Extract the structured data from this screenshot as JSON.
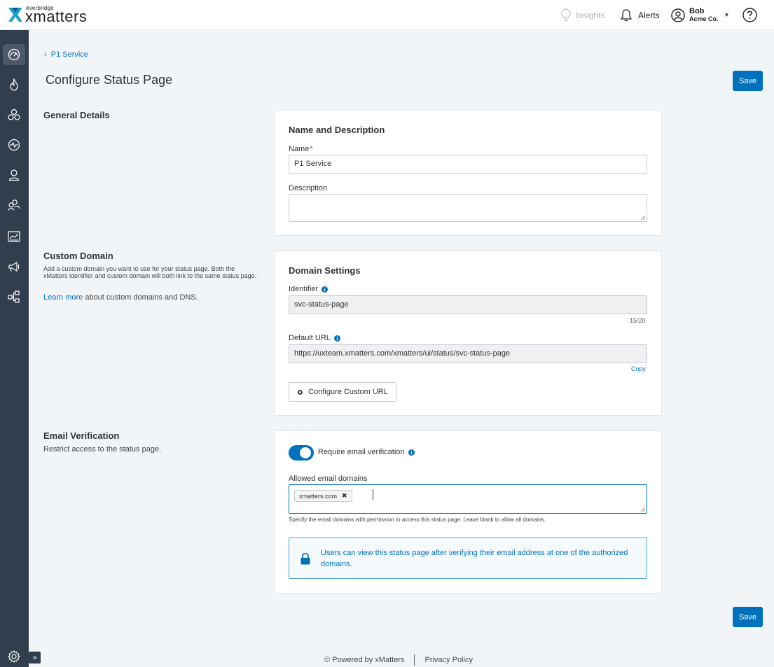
{
  "header": {
    "logo_small": "everbridge",
    "logo_big": "xmatters",
    "insights_label": "Insights",
    "alerts_label": "Alerts",
    "user_name": "Bob",
    "user_org": "Acme Co."
  },
  "sidebar": {
    "items": [
      {
        "icon": "dashboard-icon",
        "active": true
      },
      {
        "icon": "fire-icon"
      },
      {
        "icon": "services-icon"
      },
      {
        "icon": "activity-icon"
      },
      {
        "icon": "user-icon"
      },
      {
        "icon": "groups-icon"
      },
      {
        "icon": "analytics-icon"
      },
      {
        "icon": "megaphone-icon"
      },
      {
        "icon": "workflow-icon"
      }
    ],
    "settings_icon": "gear-icon",
    "expand_icon": "double-chevron-right-icon",
    "expand_label": "»"
  },
  "page": {
    "breadcrumb": "P1 Service",
    "title": "Configure Status Page",
    "save_label": "Save"
  },
  "general": {
    "section_title": "General Details",
    "card_heading": "Name and Description",
    "name_label": "Name",
    "name_required": "*",
    "name_value": "P1 Service",
    "description_label": "Description",
    "description_value": ""
  },
  "domain": {
    "section_title": "Custom Domain",
    "section_desc": "Add a custom domain you want to use for your status page. Both the xMatters identifier and custom domain will both link to the same status page.",
    "learn_more_link": "Learn more",
    "learn_more_rest": " about custom domains and DNS.",
    "card_heading": "Domain Settings",
    "identifier_label": "Identifier",
    "identifier_value": "svc-status-page",
    "identifier_count": "15/20",
    "default_url_label": "Default URL",
    "default_url_value": "https://uxteam.xmatters.com/xmatters/ui/status/svc-status-page",
    "copy_label": "Copy",
    "configure_button": "Configure Custom URL"
  },
  "email": {
    "section_title": "Email Verification",
    "section_desc": "Restrict access to the status page.",
    "toggle_label": "Require email verification",
    "toggle_on": true,
    "allowed_label": "Allowed email domains",
    "chips": [
      "xmatters.com"
    ],
    "help_text": "Specify the email domains with permission to access this status page. Leave blank to allow all domains.",
    "callout_text": "Users can view this status page after verifying their email address at one of the authorized domains."
  },
  "footer": {
    "powered_by": "© Powered by xMatters",
    "privacy": "Privacy Policy"
  },
  "colors": {
    "primary": "#0071bc",
    "sidebar": "#313e4d",
    "background": "#f2f5f8",
    "required": "#c23934"
  }
}
